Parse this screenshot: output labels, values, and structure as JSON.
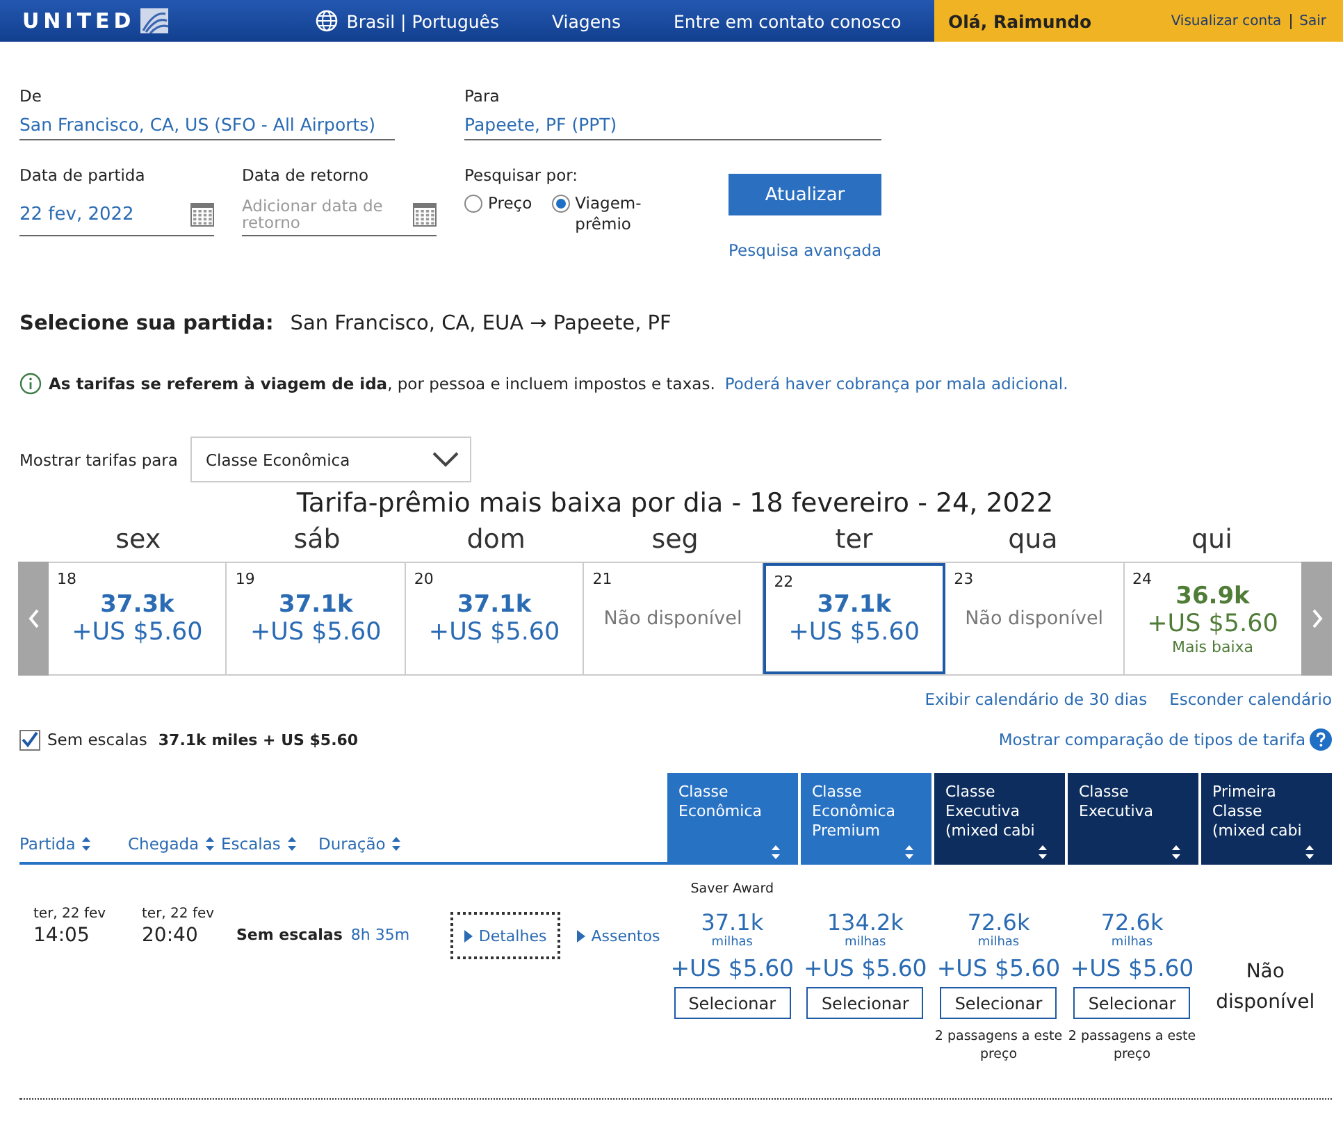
{
  "header": {
    "logo": "UNITED",
    "locale": "Brasil | Português",
    "nav": [
      "Viagens",
      "Entre em contato conosco"
    ],
    "greeting": "Olá, Raimundo",
    "account_links": [
      "Visualizar conta",
      "Sair"
    ]
  },
  "search": {
    "from": {
      "label": "De",
      "value": "San Francisco, CA, US (SFO - All Airports)"
    },
    "to": {
      "label": "Para",
      "value": "Papeete, PF (PPT)"
    },
    "depart": {
      "label": "Data de partida",
      "value": "22 fev, 2022"
    },
    "return": {
      "label": "Data de retorno",
      "placeholder": "Adicionar data de retorno"
    },
    "search_by": {
      "label": "Pesquisar por:",
      "options": [
        {
          "label": "Preço",
          "selected": false
        },
        {
          "label": "Viagem-prêmio",
          "selected": true
        }
      ]
    },
    "update_button": "Atualizar",
    "advanced_link": "Pesquisa avançada"
  },
  "heading": {
    "label": "Selecione sua partida:",
    "route": "San Francisco, CA, EUA → Papeete, PF"
  },
  "notice": {
    "text": "**As tarifas se referem à viagem de ida**, por pessoa e incluem impostos e taxas.",
    "link": "Poderá haver cobrança por mala adicional."
  },
  "fare_filter": {
    "label": "Mostrar tarifas para",
    "value": "Classe Econômica"
  },
  "calendar": {
    "title": "Tarifa-prêmio mais baixa por dia - 18 fevereiro - 24, 2022",
    "days": [
      {
        "weekday": "sex",
        "date": "18",
        "miles": "37.3k",
        "fee": "+US $5.60",
        "selected": false,
        "lowest": false
      },
      {
        "weekday": "sáb",
        "date": "19",
        "miles": "37.1k",
        "fee": "+US $5.60",
        "selected": false,
        "lowest": false
      },
      {
        "weekday": "dom",
        "date": "20",
        "miles": "37.1k",
        "fee": "+US $5.60",
        "selected": false,
        "lowest": false
      },
      {
        "weekday": "seg",
        "date": "21",
        "status": "Não disponível",
        "selected": false,
        "lowest": false
      },
      {
        "weekday": "ter",
        "date": "22",
        "miles": "37.1k",
        "fee": "+US $5.60",
        "selected": true,
        "lowest": false
      },
      {
        "weekday": "qua",
        "date": "23",
        "status": "Não disponível",
        "selected": false,
        "lowest": false
      },
      {
        "weekday": "qui",
        "date": "24",
        "miles": "36.9k",
        "fee": "+US $5.60",
        "note": "Mais baixa",
        "selected": false,
        "lowest": true
      }
    ],
    "links": [
      "Exibir calendário de 30 dias",
      "Esconder calendário"
    ]
  },
  "filters": {
    "nonstop": {
      "label": "Sem escalas",
      "checked": true
    },
    "summary": "37.1k miles + US $5.60",
    "compare_link": "Mostrar comparação de tipos de tarifa"
  },
  "table": {
    "columns": [
      "Partida",
      "Chegada",
      "Escalas",
      "Duração"
    ],
    "fare_columns": [
      {
        "lines": [
          "Classe",
          "Econômica"
        ],
        "color": "#2872c4"
      },
      {
        "lines": [
          "Classe",
          "Econômica",
          "Premium"
        ],
        "color": "#2872c4"
      },
      {
        "lines": [
          "Classe",
          "Executiva",
          "(mixed cabi"
        ],
        "color": "#0c2d5e"
      },
      {
        "lines": [
          "Classe",
          "Executiva"
        ],
        "color": "#0c2d5e"
      },
      {
        "lines": [
          "Primeira",
          "Classe",
          "(mixed cabi"
        ],
        "color": "#0c2d5e"
      }
    ],
    "flights": [
      {
        "depart_date": "ter, 22 fev",
        "depart_time": "14:05",
        "arrive_date": "ter, 22 fev",
        "arrive_time": "20:40",
        "stops": "Sem escalas",
        "duration": "8h 35m",
        "details_link": "Detalhes",
        "seats_link": "Assentos",
        "fares": [
          {
            "badge": "Saver Award",
            "miles": "37.1k",
            "unit": "milhas",
            "fee": "+US $5.60",
            "button": "Selecionar"
          },
          {
            "miles": "134.2k",
            "unit": "milhas",
            "fee": "+US $5.60",
            "button": "Selecionar"
          },
          {
            "miles": "72.6k",
            "unit": "milhas",
            "fee": "+US $5.60",
            "button": "Selecionar",
            "note": "2 passagens a este preço"
          },
          {
            "miles": "72.6k",
            "unit": "milhas",
            "fee": "+US $5.60",
            "button": "Selecionar",
            "note": "2 passagens a este preço"
          },
          {
            "status": "Não disponível"
          }
        ]
      }
    ]
  }
}
